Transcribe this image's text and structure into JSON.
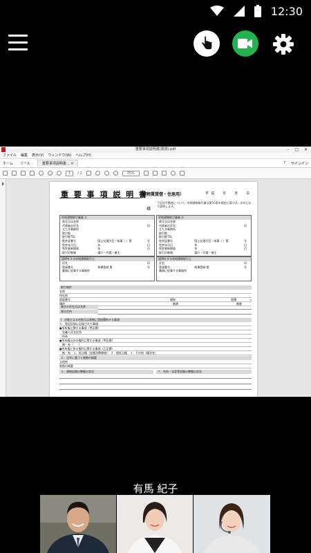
{
  "status_bar": {
    "time": "12:30",
    "icons": [
      "wifi-icon",
      "cellular-signal-icon",
      "battery-icon"
    ]
  },
  "controls": {
    "menu_icon": "hamburger-menu-icon",
    "pointer_icon": "hand-pointer-icon",
    "video_icon": "video-camera-icon",
    "settings_icon": "gear-icon",
    "video_color": "#20b34e"
  },
  "shared_screen": {
    "window_title": "重要事項説明書(賃貸).pdf",
    "window_controls": "–  □  ✕",
    "menu": [
      "ファイル",
      "編集",
      "表示(V)",
      "ウィンドウ(W)",
      "ヘルプ(H)"
    ],
    "tabs": {
      "home": "ホーム",
      "tools": "ツール",
      "document": "重要事項説明書...",
      "close": "×",
      "help": "?",
      "sign_in": "サインイン"
    },
    "toolbar": {
      "page_current": "1",
      "page_total": "/ 1",
      "zoom": "75%"
    },
    "document": {
      "title": "重 要 事 項 説 明 書",
      "subtitle": "（建物賃貸借・住居用）",
      "date": "平成　年　月　日",
      "addressee": "様",
      "notice": "下記の不動産について、宅地建物取引業法第35条の規定に基づき、次のとおり説明します。",
      "broker_left": {
        "header": "宅地建物取引業者 ①",
        "rows": [
          {
            "label": "商号又は名称",
            "mid": "",
            "right": ""
          },
          {
            "label": "代表者の氏名",
            "mid": "",
            "right": "印"
          },
          {
            "label": "主たる事務所",
            "mid": "",
            "right": ""
          },
          {
            "label": "取引態",
            "mid": "",
            "right": ""
          },
          {
            "label": "取引態TEL",
            "mid": "",
            "right": ""
          },
          {
            "label": "免許証番号",
            "mid": "国土交通大臣・知事（ ）第",
            "right": "号"
          },
          {
            "label": "免許年月日",
            "mid": "年",
            "right": "日"
          },
          {
            "label": "免許更新期限",
            "mid": "年",
            "right": "日"
          },
          {
            "label": "取引の態様",
            "mid": "媒介・代理・貸主",
            "right": ""
          }
        ],
        "staff_header": "説明をする宅地建物取引士",
        "staff_rows": [
          {
            "label": "氏名",
            "mid": "",
            "right": "印"
          },
          {
            "label": "登録番号",
            "mid": "知事登録 第",
            "right": "号"
          },
          {
            "label": "業務に従事する事務所",
            "mid": "",
            "right": ""
          }
        ]
      },
      "broker_right": {
        "header": "宅地建物取引業者 ②",
        "rows": [
          {
            "label": "商号又は名称",
            "mid": "",
            "right": ""
          },
          {
            "label": "代表者の氏名",
            "mid": "",
            "right": "印"
          },
          {
            "label": "主たる事務所",
            "mid": "",
            "right": ""
          },
          {
            "label": "取引態",
            "mid": "",
            "right": ""
          },
          {
            "label": "取引態TEL",
            "mid": "",
            "right": ""
          },
          {
            "label": "免許証番号",
            "mid": "国土交通大臣・知事（ ）第",
            "right": "号"
          },
          {
            "label": "免許年月日",
            "mid": "年",
            "right": "日"
          },
          {
            "label": "免許更新期限",
            "mid": "年",
            "right": "日"
          },
          {
            "label": "取引の態様",
            "mid": "媒介・代理・貸主",
            "right": ""
          }
        ],
        "staff_header": "説明をする宅地建物取引士",
        "staff_rows": [
          {
            "label": "氏名",
            "mid": "",
            "right": "印"
          },
          {
            "label": "登録番号",
            "mid": "知事登録 第",
            "right": "号"
          },
          {
            "label": "業務に従事する事務所",
            "mid": "",
            "right": ""
          }
        ]
      },
      "property": {
        "header": "取引物件",
        "rows": [
          "名称",
          "所在地",
          "部屋番号　　　　　　　　　　　　　　　　　　　　　　　　　　　　　　　　　　　　間取　　　　　　　　　　　　　　　　　　　　面積　　　　　㎡（登記面積）",
          "構造　　　　　　　　　　　　　　　　　　　　　　　　　　　　　　　　　　　　　　　階建　　　　　　　　　　　　　　　　　　　　　階層　　　　　　　　　　　　　　階部分"
        ]
      },
      "lessor": {
        "name_label": "貸主の氏名又は名称",
        "address_label": "貸主住所"
      },
      "section1": {
        "header": "Ⅰ　対象となる宅地又は建物に直接関係する事項",
        "lines": [
          "１．登記記録に記録された事項",
          "●所有権に関する事項（甲区欄）",
          "　名義人氏名住所",
          "　所有",
          "●所有権以外の権利に関する事項（甲区欄）",
          "　無・有（　　）",
          "●所有権に係る権利に関する事項（乙区欄）",
          "　無・有　１．抵当権（金銭消費貸借）　２．根抵当権　３．その他（権利名）"
        ]
      },
      "section2": {
        "header": "２．法令に基づく制限の概要",
        "lines": [
          "立地他",
          "制限の概要"
        ]
      },
      "section3": {
        "left": "３．建物設備の整備の状況",
        "right": "７．台所・浴室等設備の整備の状況"
      }
    }
  },
  "caller": {
    "name": "有馬 紀子"
  },
  "participants": [
    {
      "id": "participant-1",
      "bg": "#7a7a6e"
    },
    {
      "id": "participant-2",
      "bg": "#e9e9e7"
    },
    {
      "id": "participant-3",
      "bg": "#dadfe3"
    }
  ]
}
